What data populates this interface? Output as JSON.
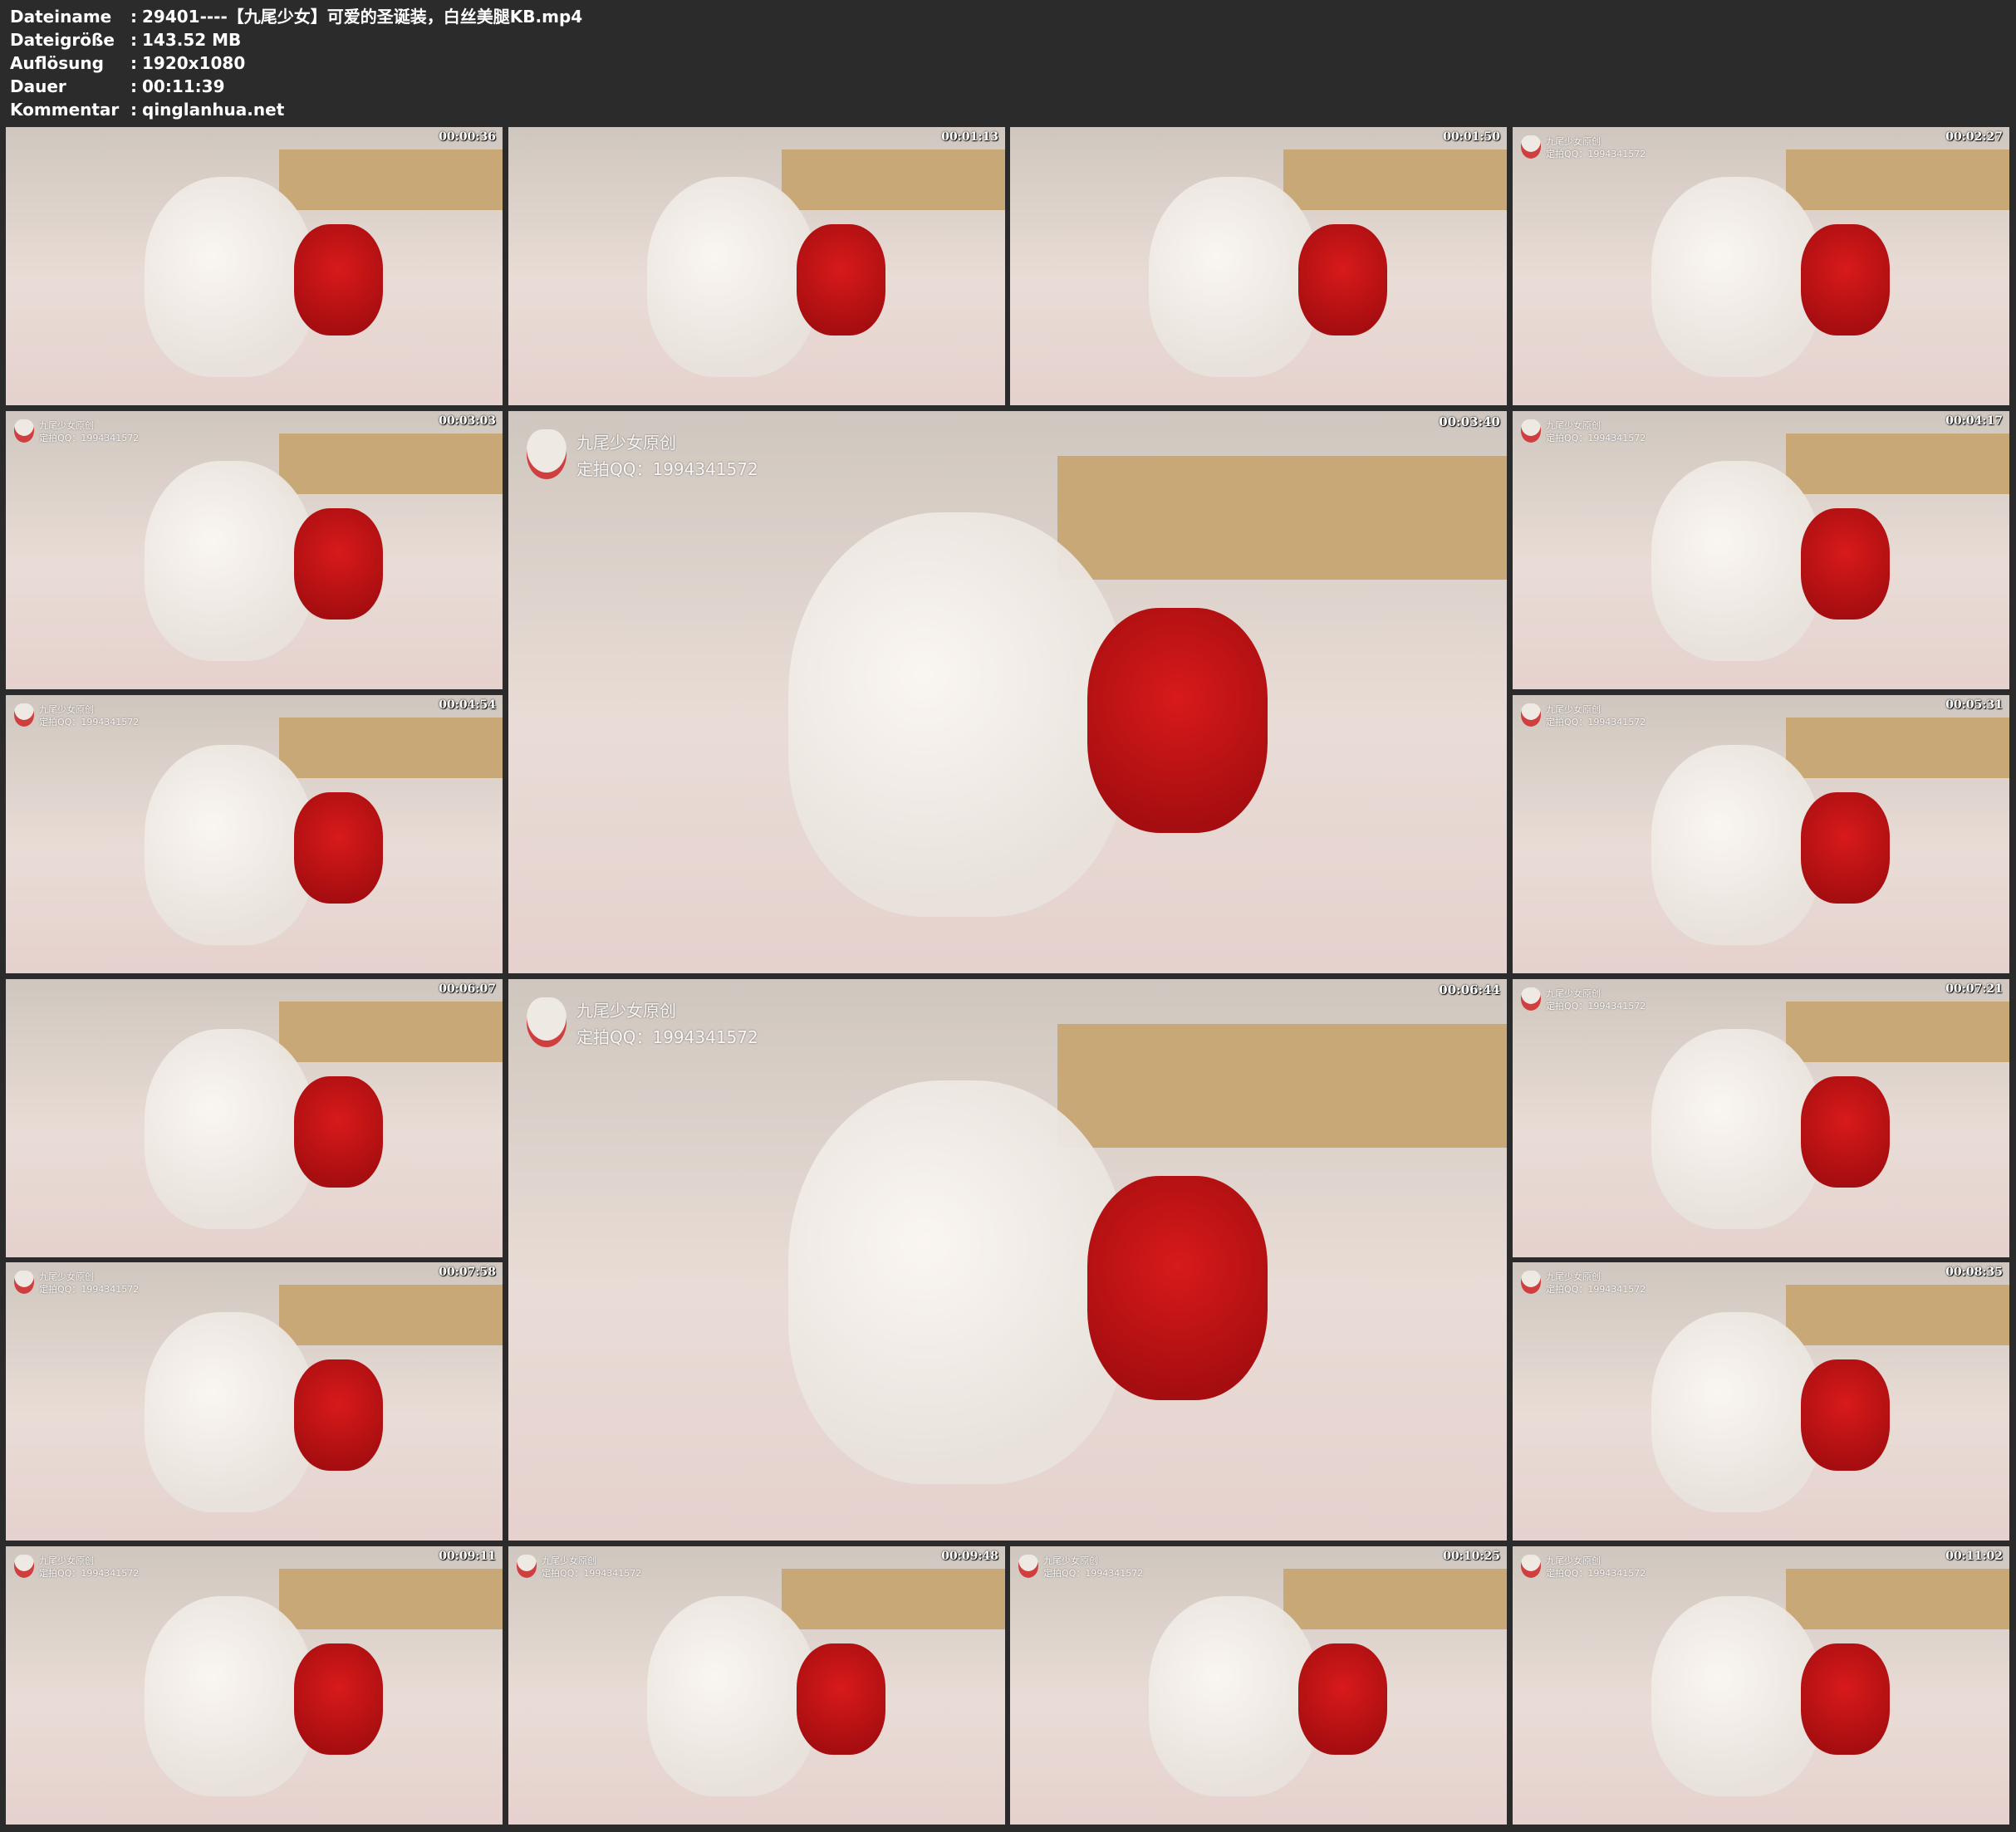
{
  "meta": [
    {
      "key": "Dateiname",
      "value": "29401----【九尾少女】可爱的圣诞装，白丝美腿KB.mp4"
    },
    {
      "key": "Dateigröße",
      "value": "143.52 MB"
    },
    {
      "key": "Auflösung",
      "value": "1920x1080"
    },
    {
      "key": "Dauer",
      "value": "00:11:39"
    },
    {
      "key": "Kommentar",
      "value": "qinglanhua.net"
    }
  ],
  "separator": ":",
  "watermark": {
    "line1": "九尾少女原创",
    "line2": "定拍QQ：1994341572"
  },
  "thumbnails": [
    {
      "time": "00:00:36"
    },
    {
      "time": "00:01:13"
    },
    {
      "time": "00:01:50"
    },
    {
      "time": "00:02:27"
    },
    {
      "time": "00:03:03"
    },
    {
      "time": "00:03:40"
    },
    {
      "time": "00:04:17"
    },
    {
      "time": "00:04:54"
    },
    {
      "time": "00:05:31"
    },
    {
      "time": "00:06:07"
    },
    {
      "time": "00:06:44"
    },
    {
      "time": "00:07:21"
    },
    {
      "time": "00:07:58"
    },
    {
      "time": "00:08:35"
    },
    {
      "time": "00:09:11"
    },
    {
      "time": "00:09:48"
    },
    {
      "time": "00:10:25"
    },
    {
      "time": "00:11:02"
    }
  ]
}
